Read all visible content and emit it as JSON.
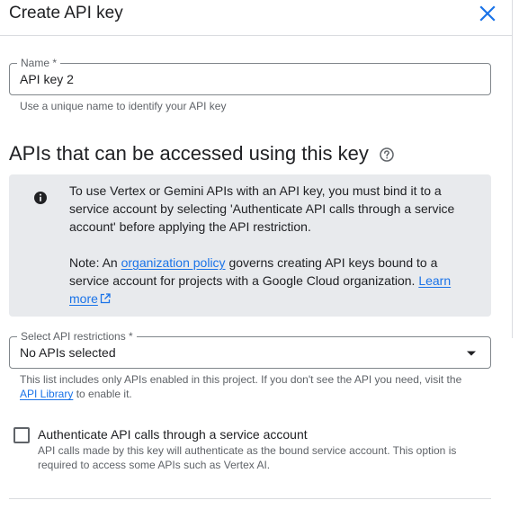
{
  "header": {
    "title": "Create API key",
    "close_icon": "close-icon"
  },
  "name_field": {
    "label": "Name *",
    "value": "API key 2",
    "helper": "Use a unique name to identify your API key"
  },
  "api_section": {
    "heading": "APIs that can be accessed using this key",
    "help_icon": "help-circle-icon",
    "info": {
      "icon": "info-icon",
      "paragraph1": "To use Vertex or Gemini APIs with an API key, you must bind it to a service account by selecting 'Authenticate API calls through a service account' before applying the API restriction.",
      "note_prefix": "Note: An ",
      "org_policy_link": "organization policy",
      "note_middle": " governs creating API keys bound to a service account for projects with a Google Cloud organization. ",
      "learn_more_link": "Learn more",
      "external_link_icon": "external-link-icon"
    }
  },
  "restrictions": {
    "label": "Select API restrictions *",
    "selected": "No APIs selected",
    "dropdown_icon": "dropdown-arrow-icon",
    "helper_prefix": "This list includes only APIs enabled in this project. If you don't see the API you need, visit the",
    "api_library_link": "API Library",
    "helper_suffix": " to enable it."
  },
  "service_account": {
    "checked": false,
    "label": "Authenticate API calls through a service account",
    "description": "API calls made by this key will authenticate as the bound service account. This option is required to access some APIs such as Vertex AI."
  },
  "colors": {
    "accent": "#1a73e8",
    "info_background": "#e8eaed",
    "text_primary": "#202124",
    "text_secondary": "#5f6368"
  }
}
